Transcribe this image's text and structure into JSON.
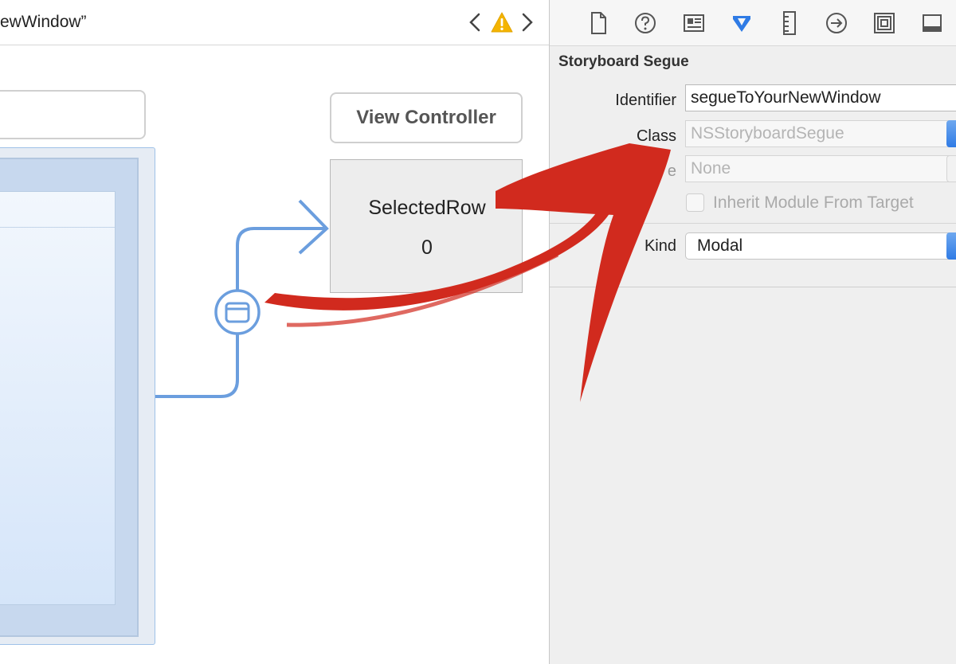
{
  "canvas": {
    "title": "ewWindow”",
    "view_controller_title": "View Controller",
    "scene_label": "SelectedRow",
    "scene_value": "0"
  },
  "inspector": {
    "toolbar_icons": [
      "file-inspector-icon",
      "help-icon",
      "identity-icon",
      "attributes-icon",
      "size-icon",
      "connections-icon",
      "bindings-icon",
      "effects-icon"
    ],
    "section_title": "Storyboard Segue",
    "identifier_label": "Identifier",
    "identifier_value": "segueToYourNewWindow",
    "class_label": "Class",
    "class_value": "NSStoryboardSegue",
    "module_label": "e",
    "module_value": "None",
    "inherit_label": "Inherit Module From Target",
    "kind_label": "Kind",
    "kind_value": "Modal"
  },
  "colors": {
    "segue_line": "#6b9ede",
    "annotation_arrow": "#d12a1e",
    "warning": "#f4b400",
    "accent_blue": "#2f7be5"
  }
}
